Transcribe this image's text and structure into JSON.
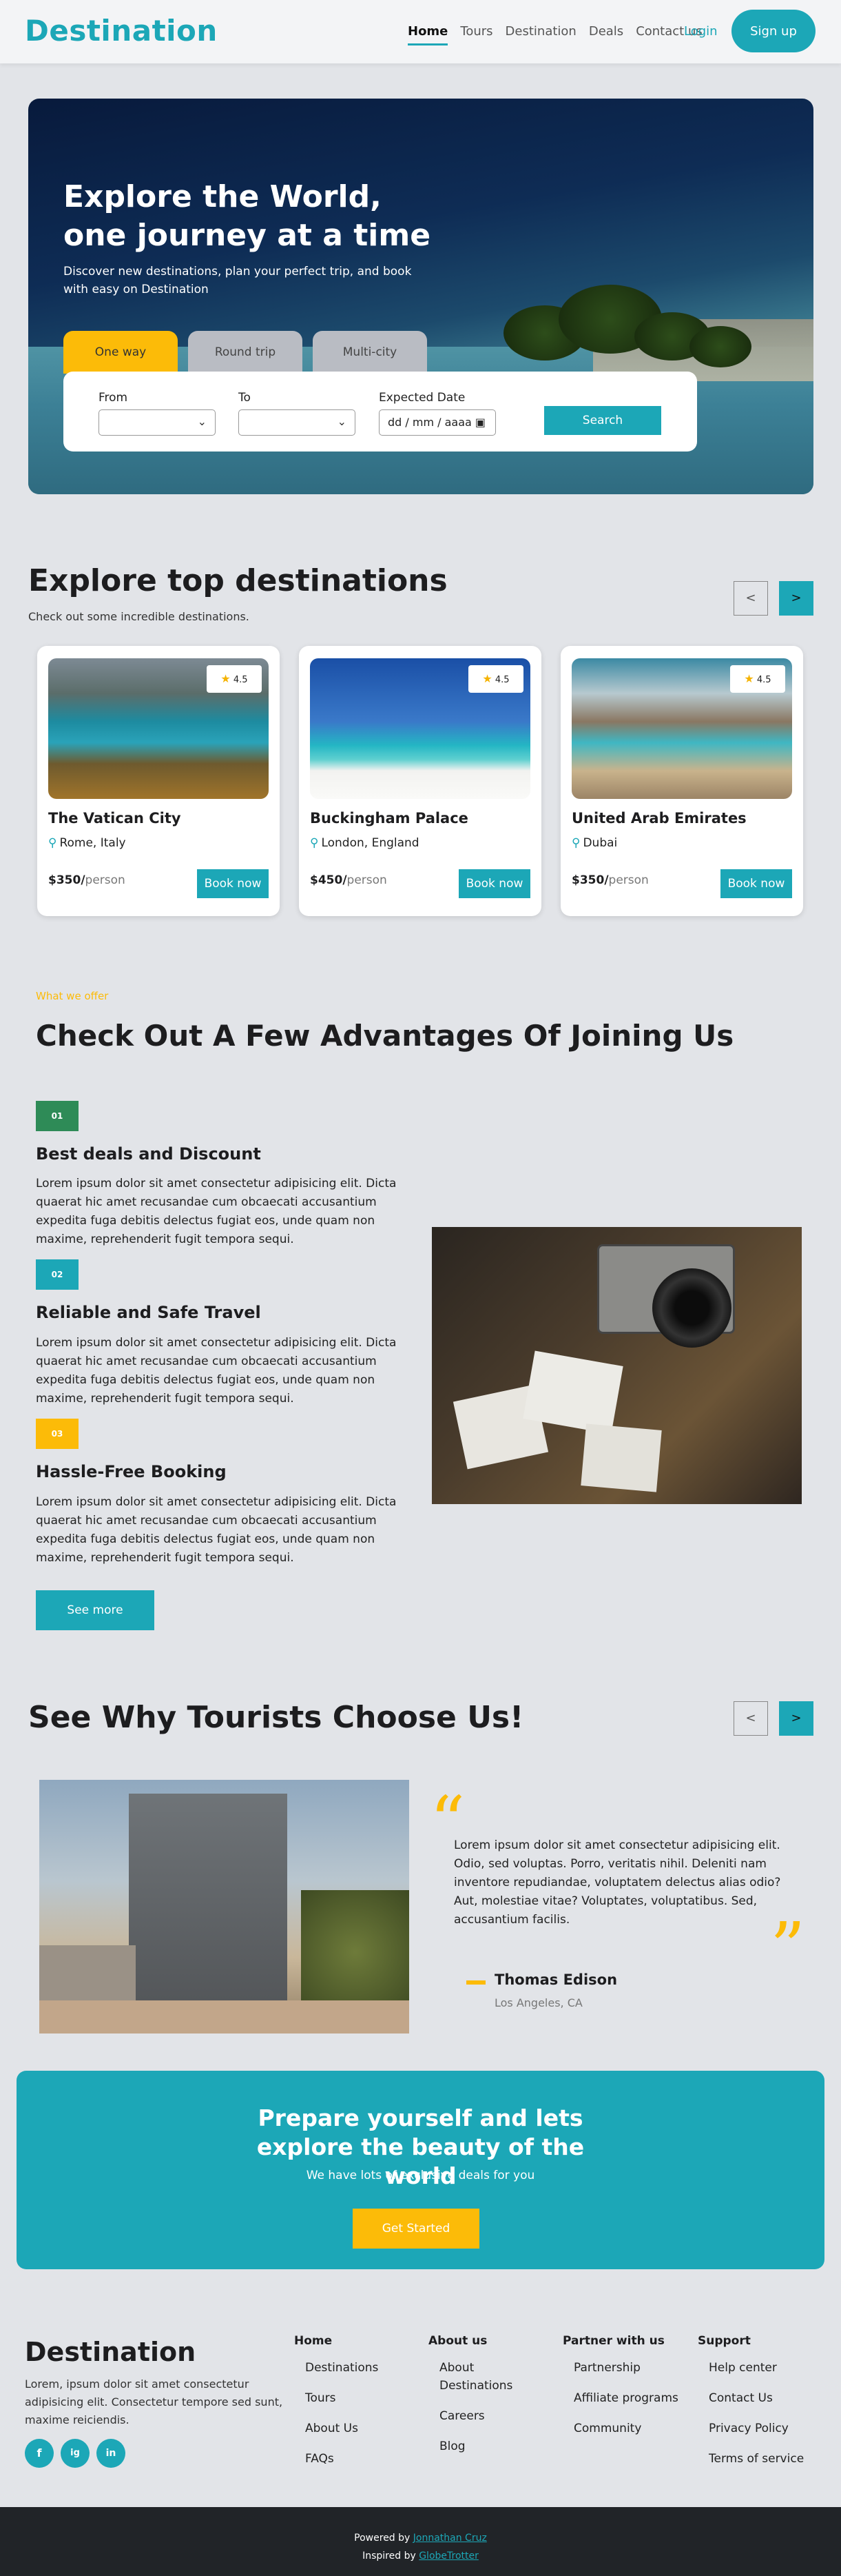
{
  "nav": {
    "brand": "Destination",
    "links": [
      "Home",
      "Tours",
      "Destination",
      "Deals",
      "Contact us"
    ],
    "login": "Login",
    "signup": "Sign up"
  },
  "hero": {
    "title": "Explore the World, one journey at a time",
    "subtitle": "Discover new destinations, plan your perfect trip, and book with easy on Destination",
    "tabs": [
      "One way",
      "Round trip",
      "Multi-city"
    ],
    "active_tab": "One way",
    "from_label": "From",
    "to_label": "To",
    "date_label": "Expected Date",
    "date_placeholder": "dd / mm / aaaa",
    "search_button": "Search"
  },
  "destinations": {
    "title": "Explore top destinations",
    "subtitle": "Check out some incredible destinations.",
    "prev": "<",
    "next": ">",
    "cards": [
      {
        "name": "The Vatican City",
        "location": "Rome, Italy",
        "rating": "4.5",
        "price": "$350/",
        "unit": "person",
        "book": "Book now"
      },
      {
        "name": "Buckingham Palace",
        "location": "London, England",
        "rating": "4.5",
        "price": "$450/",
        "unit": "person",
        "book": "Book now"
      },
      {
        "name": "United Arab Emirates",
        "location": "Dubai",
        "rating": "4.5",
        "price": "$350/",
        "unit": "person",
        "book": "Book now"
      }
    ]
  },
  "advantages": {
    "kicker": "What we offer",
    "title": "Check Out A Few Advantages Of Joining Us",
    "items": [
      {
        "num": "01",
        "color": "#2e8b57",
        "heading": "Best deals and Discount",
        "text": "Lorem ipsum dolor sit amet consectetur adipisicing elit. Dicta quaerat hic amet recusandae cum obcaecati accusantium expedita fuga debitis delectus fugiat eos, unde quam non maxime, reprehenderit fugit tempora sequi."
      },
      {
        "num": "02",
        "color": "#1ca7b7",
        "heading": "Reliable and Safe Travel",
        "text": "Lorem ipsum dolor sit amet consectetur adipisicing elit. Dicta quaerat hic amet recusandae cum obcaecati accusantium expedita fuga debitis delectus fugiat eos, unde quam non maxime, reprehenderit fugit tempora sequi."
      },
      {
        "num": "03",
        "color": "#fcbb08",
        "heading": "Hassle-Free Booking",
        "text": "Lorem ipsum dolor sit amet consectetur adipisicing elit. Dicta quaerat hic amet recusandae cum obcaecati accusantium expedita fuga debitis delectus fugiat eos, unde quam non maxime, reprehenderit fugit tempora sequi."
      }
    ],
    "see_more": "See more"
  },
  "testimonial": {
    "title": "See Why Tourists Choose Us!",
    "prev": "<",
    "next": ">",
    "quote": "Lorem ipsum dolor sit amet consectetur adipisicing elit. Odio, sed voluptas. Porro, veritatis nihil. Deleniti nam inventore repudiandae, voluptatem delectus alias odio? Aut, molestiae vitae? Voluptates, voluptatibus. Sed, accusantium facilis.",
    "name": "Thomas Edison",
    "location": "Los Angeles, CA"
  },
  "cta": {
    "title": "Prepare yourself and lets explore the beauty of the world",
    "subtitle": "We have lots of exclusive deals for you",
    "button": "Get Started"
  },
  "footer": {
    "brand": "Destination",
    "description": "Lorem, ipsum dolor sit amet consectetur adipisicing elit. Consectetur tempore sed sunt, maxime reiciendis.",
    "social": [
      "f",
      "ig",
      "in"
    ],
    "columns": [
      {
        "heading": "Home",
        "links": [
          "Destinations",
          "Tours",
          "About Us",
          "FAQs"
        ]
      },
      {
        "heading": "About us",
        "links": [
          "About Destinations",
          "Careers",
          "Blog"
        ]
      },
      {
        "heading": "Partner with us",
        "links": [
          "Partnership",
          "Affiliate programs",
          "Community"
        ]
      },
      {
        "heading": "Support",
        "links": [
          "Help center",
          "Contact Us",
          "Privacy Policy",
          "Terms of service"
        ]
      }
    ],
    "powered_prefix": "Powered by ",
    "powered_name": "Jonnathan Cruz",
    "inspired_prefix": "Inspired by ",
    "inspired_name": "GlobeTrotter"
  },
  "colors": {
    "primary": "#1ca7b7",
    "accent": "#fcbb08",
    "dark": "#212428",
    "background": "#e2e4e8"
  }
}
